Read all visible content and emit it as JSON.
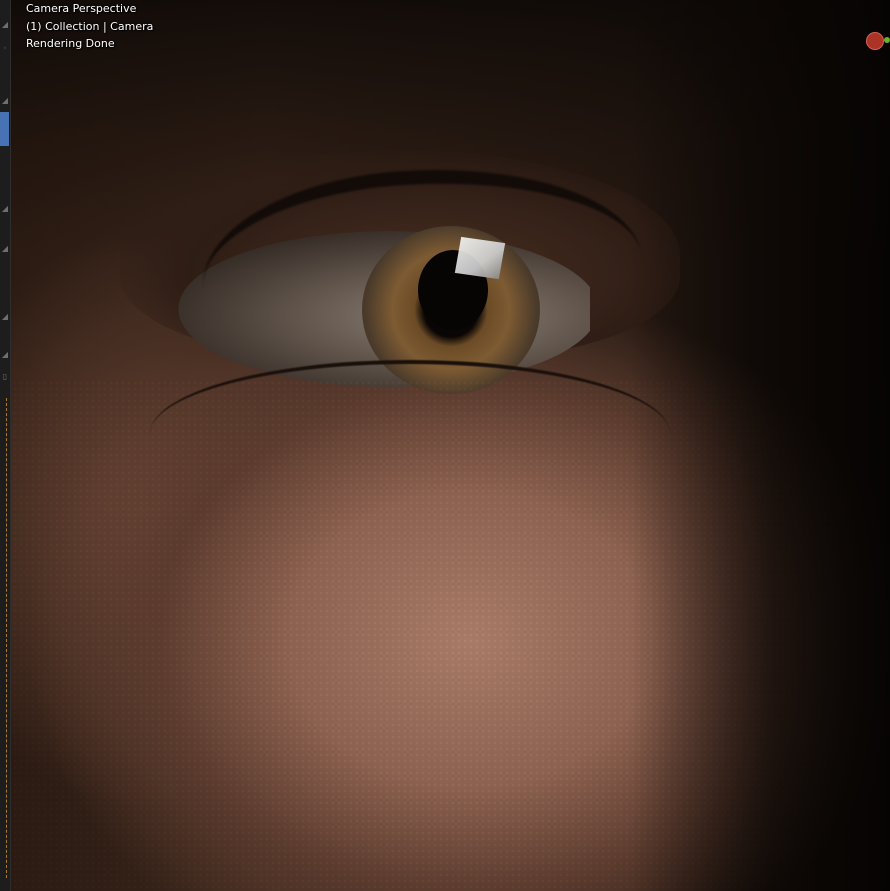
{
  "viewport": {
    "overlay": {
      "line1": "Camera Perspective",
      "line2": "(1) Collection | Camera",
      "line3": "Rendering Done"
    }
  },
  "gizmo": {
    "x_color": "#c0392b",
    "y_color": "#6fae2e"
  },
  "toolbar": {
    "active_color": "#4772b3"
  }
}
